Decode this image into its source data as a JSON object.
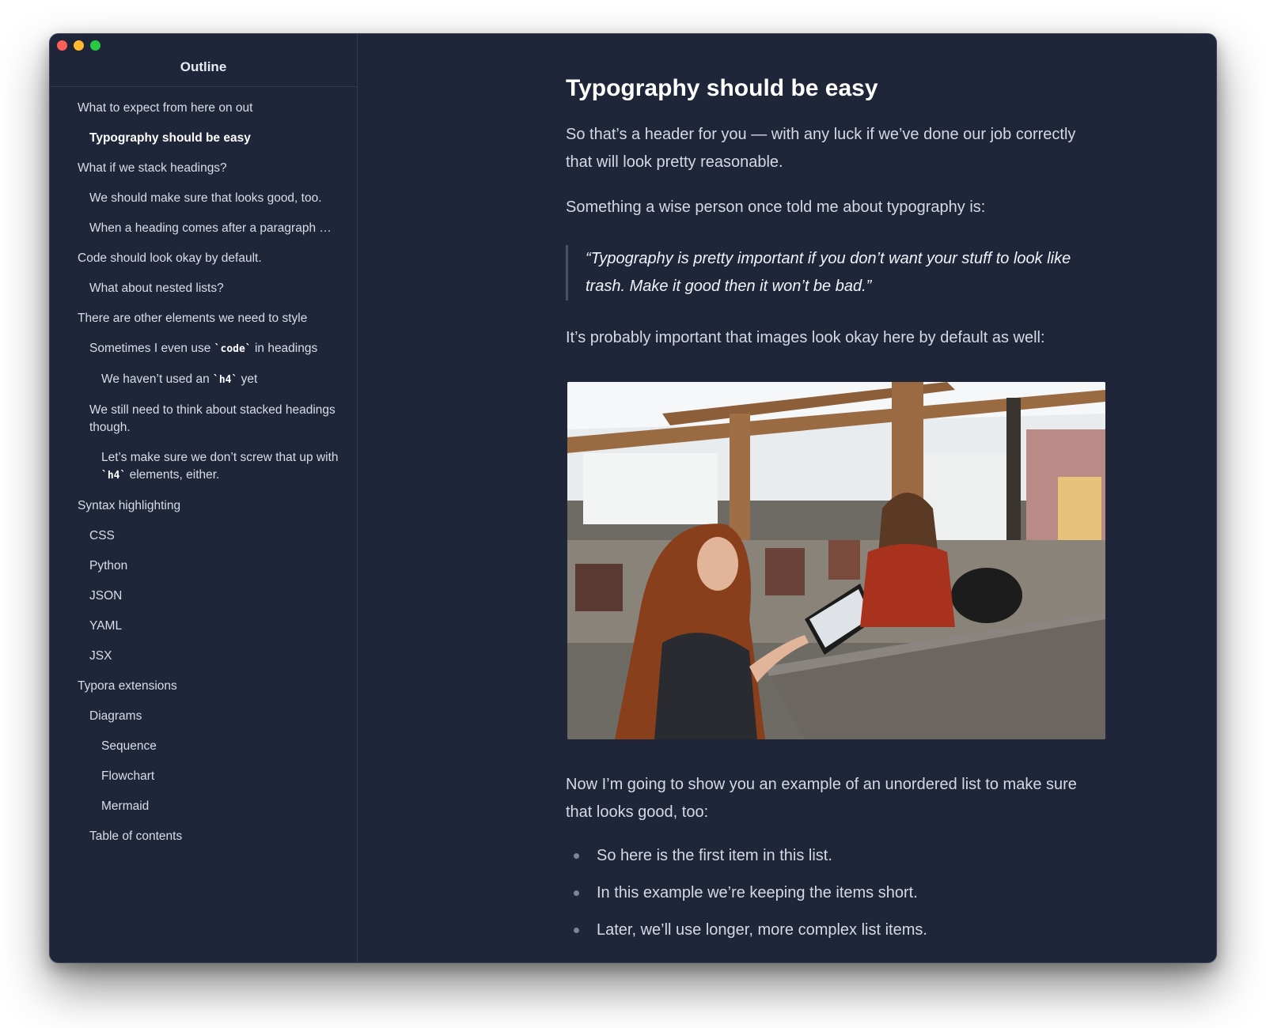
{
  "sidebar": {
    "title": "Outline",
    "items": [
      {
        "label": "What to expect from here on out"
      },
      {
        "label": "Typography should be easy"
      },
      {
        "label": "What if we stack headings?"
      },
      {
        "label": "We should make sure that looks good, too."
      },
      {
        "label": "When a heading comes after a paragraph …"
      },
      {
        "label": "Code should look okay by default."
      },
      {
        "label": "What about nested lists?"
      },
      {
        "label": "There are other elements we need to style"
      },
      {
        "pre": "Sometimes I even use ",
        "code": "`code`",
        "post": " in headings"
      },
      {
        "pre": "We haven’t used an ",
        "code": "`h4`",
        "post": " yet"
      },
      {
        "label": "We still need to think about stacked headings though."
      },
      {
        "pre": "Let’s make sure we don’t screw that up with ",
        "code": "`h4`",
        "post": " elements, either."
      },
      {
        "label": "Syntax highlighting"
      },
      {
        "label": "CSS"
      },
      {
        "label": "Python"
      },
      {
        "label": "JSON"
      },
      {
        "label": "YAML"
      },
      {
        "label": "JSX"
      },
      {
        "label": "Typora extensions"
      },
      {
        "label": "Diagrams"
      },
      {
        "label": "Sequence"
      },
      {
        "label": "Flowchart"
      },
      {
        "label": "Mermaid"
      },
      {
        "label": "Table of contents"
      }
    ]
  },
  "article": {
    "heading": "Typography should be easy",
    "paragraph_1": "So that’s a header for you — with any luck if we’ve done our job correctly that will look pretty reasonable.",
    "paragraph_2": "Something a wise person once told me about typography is:",
    "quote": "“Typography is pretty important if you don’t want your stuff to look like trash. Make it good then it won’t be bad.”",
    "paragraph_3": "It’s probably important that images look okay here by default as well:",
    "paragraph_4": "Now I’m going to show you an example of an unordered list to make sure that looks good, too:",
    "bullets": [
      "So here is the first item in this list.",
      "In this example we’re keeping the items short.",
      "Later, we’ll use longer, more complex list items."
    ]
  },
  "colors": {
    "window_bg": "#1f2639",
    "text": "#d4d9e4",
    "heading": "#ffffff"
  }
}
